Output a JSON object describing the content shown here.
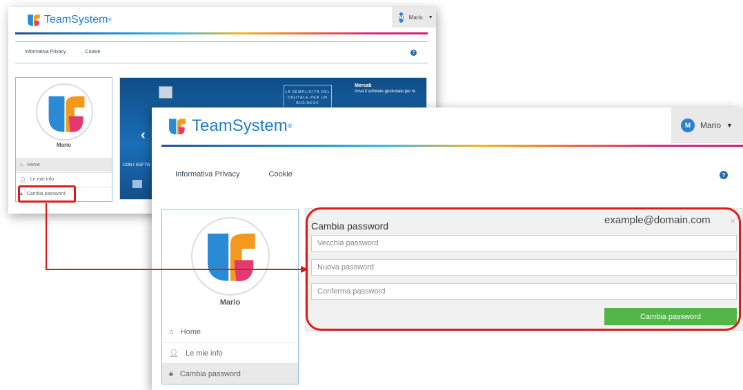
{
  "brand": {
    "name": "TeamSystem",
    "reg": "®"
  },
  "user": {
    "name": "Mario",
    "initial": "M"
  },
  "menu": {
    "privacy": "Informativa Privacy",
    "cookie": "Cookie",
    "help": "?"
  },
  "profile": {
    "name": "Mario"
  },
  "nav": [
    {
      "label": "Home",
      "icon": "home-icon"
    },
    {
      "label": "Le mie info",
      "icon": "user-icon"
    },
    {
      "label": "Cambia password",
      "icon": "lock-icon"
    }
  ],
  "carousel": {
    "panel_text": "LA SEMPLICITÀ DEL DIGITALE PER UN BUSINESS",
    "right_title": "Mercati",
    "right_text": "trova il software gestionale per te",
    "caption": "CON I SOFTW"
  },
  "modal": {
    "title": "Cambia password",
    "close": "×",
    "old_placeholder": "Vecchia password",
    "new_placeholder": "Nuova password",
    "confirm_placeholder": "Conferma password",
    "submit_label": "Cambia password"
  },
  "email_overlay": "example@domain.com",
  "colors": {
    "brand_blue": "#1f7ec7",
    "accent_red": "#e01818",
    "button_green": "#54b54a"
  }
}
